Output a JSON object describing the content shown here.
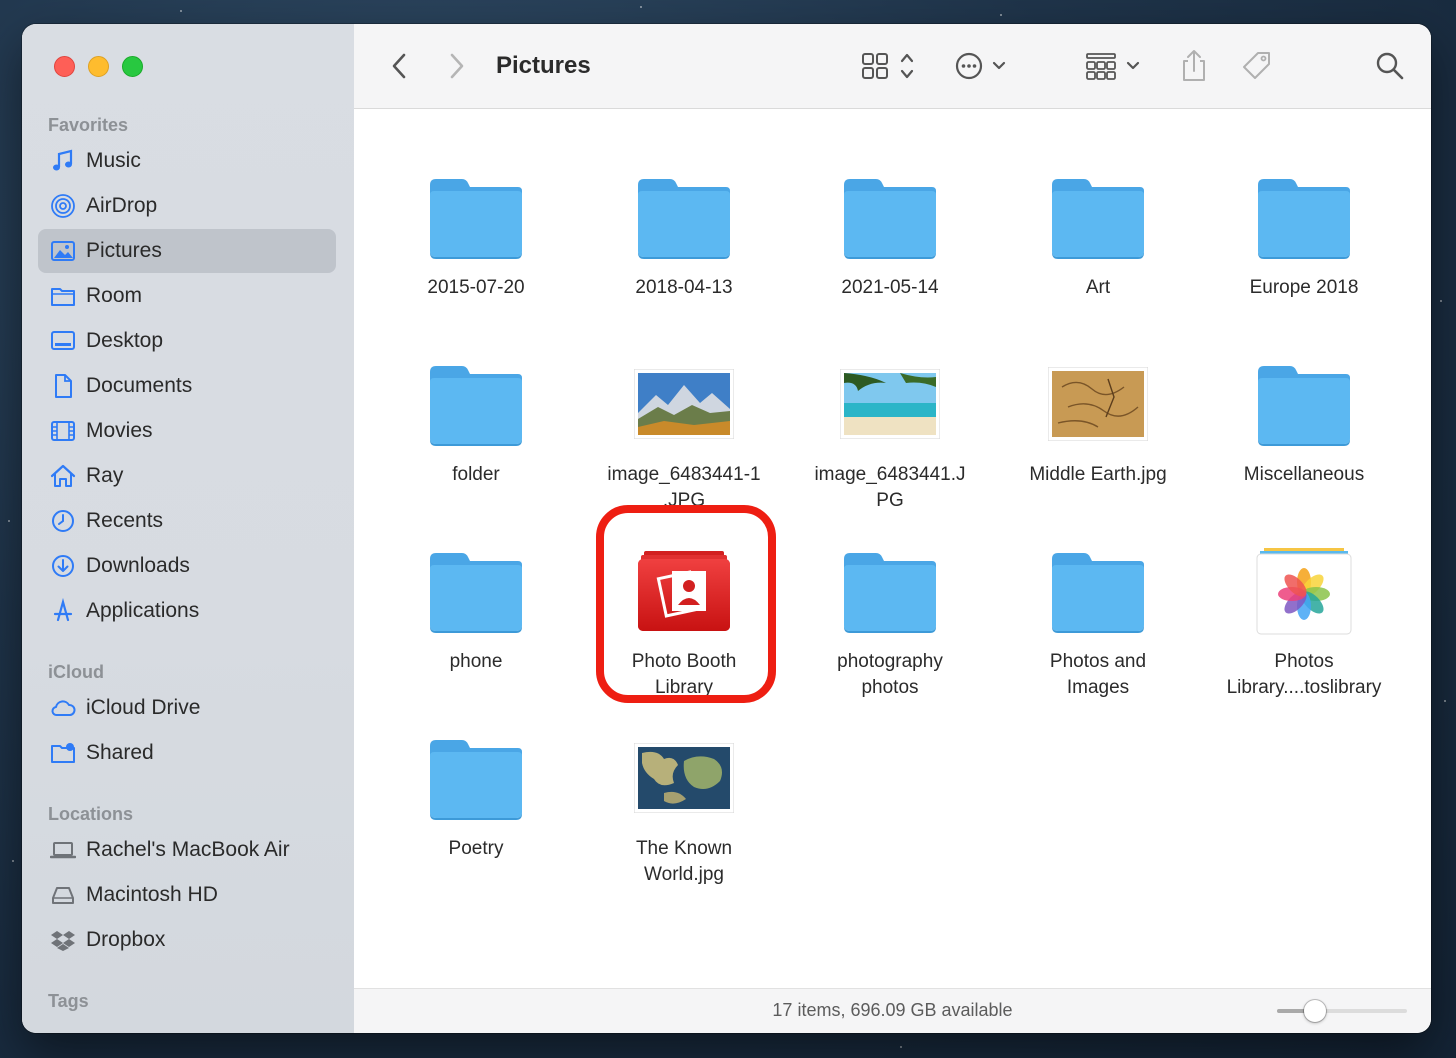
{
  "window": {
    "title": "Pictures"
  },
  "sidebar": {
    "favorites_header": "Favorites",
    "favorites": [
      {
        "label": "Music",
        "icon": "music-note-icon"
      },
      {
        "label": "AirDrop",
        "icon": "airdrop-icon"
      },
      {
        "label": "Pictures",
        "icon": "photo-icon",
        "active": true
      },
      {
        "label": "Room",
        "icon": "folder-icon"
      },
      {
        "label": "Desktop",
        "icon": "desktop-icon"
      },
      {
        "label": "Documents",
        "icon": "document-icon"
      },
      {
        "label": "Movies",
        "icon": "film-icon"
      },
      {
        "label": "Ray",
        "icon": "home-icon"
      },
      {
        "label": "Recents",
        "icon": "clock-icon"
      },
      {
        "label": "Downloads",
        "icon": "download-icon"
      },
      {
        "label": "Applications",
        "icon": "applications-icon"
      }
    ],
    "icloud_header": "iCloud",
    "icloud": [
      {
        "label": "iCloud Drive",
        "icon": "cloud-icon"
      },
      {
        "label": "Shared",
        "icon": "shared-folder-icon"
      }
    ],
    "locations_header": "Locations",
    "locations": [
      {
        "label": "Rachel's MacBook Air",
        "icon": "laptop-icon"
      },
      {
        "label": "Macintosh HD",
        "icon": "hard-drive-icon"
      },
      {
        "label": "Dropbox",
        "icon": "dropbox-icon"
      }
    ],
    "tags_header": "Tags"
  },
  "files": [
    {
      "label": "2015-07-20",
      "kind": "folder"
    },
    {
      "label": "2018-04-13",
      "kind": "folder"
    },
    {
      "label": "2021-05-14",
      "kind": "folder"
    },
    {
      "label": "Art",
      "kind": "folder"
    },
    {
      "label": "Europe 2018",
      "kind": "folder"
    },
    {
      "label": "folder",
      "kind": "folder"
    },
    {
      "label": "image_6483441-1\n.JPG",
      "kind": "image-mountains"
    },
    {
      "label": "image_6483441.J\nPG",
      "kind": "image-beach"
    },
    {
      "label": "Middle Earth.jpg",
      "kind": "image-map"
    },
    {
      "label": "Miscellaneous",
      "kind": "folder"
    },
    {
      "label": "phone",
      "kind": "folder"
    },
    {
      "label": "Photo Booth\nLibrary",
      "kind": "photobooth"
    },
    {
      "label": "photography\nphotos",
      "kind": "folder"
    },
    {
      "label": "Photos and\nImages",
      "kind": "folder"
    },
    {
      "label": "Photos\nLibrary....toslibrary",
      "kind": "photos-library"
    },
    {
      "label": "Poetry",
      "kind": "folder"
    },
    {
      "label": "The Known\nWorld.jpg",
      "kind": "image-world-map"
    }
  ],
  "status": {
    "text": "17 items, 696.09 GB available",
    "zoom": 0.25
  },
  "colors": {
    "folder": "#5cb8f2",
    "highlight": "#ee1e12",
    "accent": "#2f7bf6"
  }
}
